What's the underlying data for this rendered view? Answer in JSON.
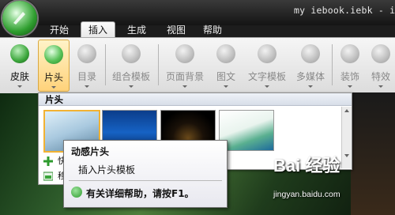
{
  "window": {
    "title": "my iebook.iebk - i"
  },
  "tabs": [
    {
      "label": "开始"
    },
    {
      "label": "插入"
    },
    {
      "label": "生成"
    },
    {
      "label": "视图"
    },
    {
      "label": "帮助"
    }
  ],
  "active_tab": "插入",
  "ribbon": {
    "buttons": [
      {
        "label": "皮肤",
        "icon": "skin-icon",
        "enabled": true
      },
      {
        "label": "片头",
        "icon": "intro-icon",
        "enabled": true,
        "highlighted": true
      },
      {
        "label": "目录",
        "icon": "catalog-icon",
        "enabled": false
      },
      {
        "label": "组合模板",
        "icon": "combo-template-icon",
        "enabled": false
      },
      {
        "label": "页面背景",
        "icon": "page-background-icon",
        "enabled": false
      },
      {
        "label": "图文",
        "icon": "image-text-icon",
        "enabled": false
      },
      {
        "label": "文字模板",
        "icon": "text-template-icon",
        "enabled": false
      },
      {
        "label": "多媒体",
        "icon": "multimedia-icon",
        "enabled": false
      },
      {
        "label": "装饰",
        "icon": "decoration-icon",
        "enabled": false
      },
      {
        "label": "特效",
        "icon": "effects-icon",
        "enabled": false
      }
    ]
  },
  "dropdown": {
    "header": "片头",
    "thumbnails": [
      {
        "name": "intro-thumbnail-1",
        "selected": true
      },
      {
        "name": "intro-thumbnail-2",
        "selected": false
      },
      {
        "name": "intro-thumbnail-3",
        "selected": false
      },
      {
        "name": "intro-thumbnail-4",
        "selected": false
      }
    ],
    "menu_items": [
      {
        "label": "快",
        "icon": "add-icon"
      },
      {
        "label": "移",
        "icon": "image-icon"
      }
    ]
  },
  "tooltip": {
    "title": "动感片头",
    "description": "插入片头模板",
    "help": "有关详细帮助，请按F1。"
  },
  "watermark": {
    "text": "Bai 经验",
    "url": "jingyan.baidu.com"
  },
  "colors": {
    "accent_highlight": "#ffd27a",
    "ribbon_bg": "#e8e8e8",
    "titlebar_bg": "#1f1f1f",
    "orb_green": "#2f9e2f"
  }
}
